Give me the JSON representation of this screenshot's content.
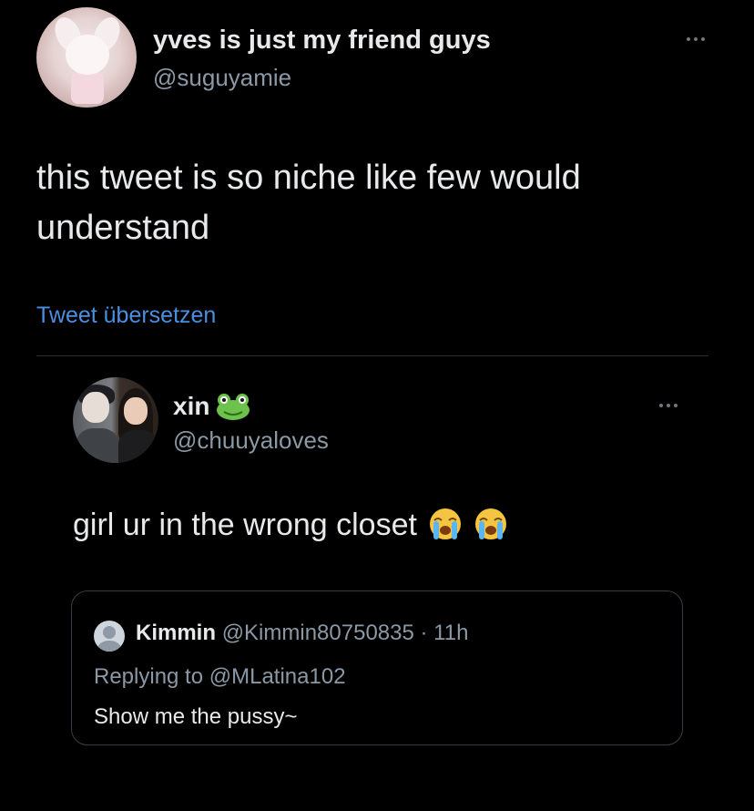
{
  "tweet": {
    "display_name": "yves is just my friend guys",
    "handle": "@suguyamie",
    "text": "this tweet is so niche like few would understand",
    "translate_label": "Tweet übersetzen",
    "avatar_icon": "avatar-plush-bunny",
    "more_icon": "ellipsis-icon"
  },
  "quoted_tweet": {
    "display_name": "xin",
    "name_emoji": "frog-face-emoji",
    "handle": "@chuuyaloves",
    "text": "girl ur in the wrong closet",
    "text_emoji": [
      "loudly-crying-face-emoji",
      "loudly-crying-face-emoji"
    ],
    "avatar_icon": "avatar-two-people",
    "more_icon": "ellipsis-icon"
  },
  "embedded_reply": {
    "display_name": "Kimmin",
    "handle_time": "@Kimmin80750835 · 11h",
    "replying_prefix": "Replying to ",
    "replying_to": "@MLatina102",
    "text": "Show me the pussy~",
    "avatar_icon": "default-avatar-icon"
  },
  "colors": {
    "background": "#000000",
    "primary_text": "#e7e9ea",
    "secondary_text": "#8b98a5",
    "link": "#4a8fe0",
    "border": "#3a3e43"
  }
}
